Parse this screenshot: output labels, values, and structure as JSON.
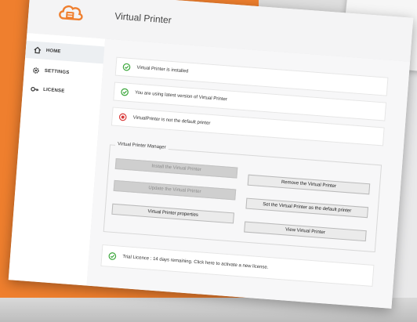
{
  "app": {
    "title": "Virtual Printer"
  },
  "sidebar": {
    "items": [
      {
        "label": "HOME",
        "icon": "home-icon",
        "active": true
      },
      {
        "label": "SETTINGS",
        "icon": "gear-icon",
        "active": false
      },
      {
        "label": "LICENSE",
        "icon": "key-icon",
        "active": false
      }
    ]
  },
  "status": {
    "items": [
      {
        "text": "Virtual Printer is installed",
        "state": "ok"
      },
      {
        "text": "You are using latest version of Virtual Printer",
        "state": "ok"
      },
      {
        "text": "VirtualPrinter is not the default printer",
        "state": "error"
      }
    ]
  },
  "manager": {
    "label": "Virtual Printer Manager",
    "buttons": {
      "install": "Install the Virtual Printer",
      "remove": "Remove the Virtual Printer",
      "update": "Update the Virtual Printer",
      "set_default": "Set the Virtual Printer as the default printer",
      "properties": "Virtual Printer properties",
      "view": "View Virtual Printer"
    }
  },
  "license": {
    "text": "Trial Licence : 14 days remaining. Click here to activate a new license."
  },
  "colors": {
    "accent": "#ef7f2e",
    "ok": "#3aa63a",
    "error": "#d93b3b"
  }
}
